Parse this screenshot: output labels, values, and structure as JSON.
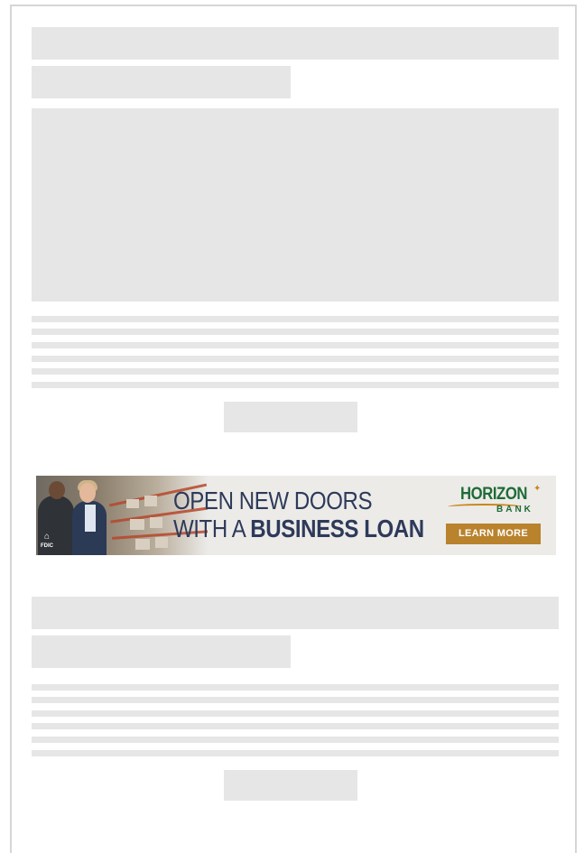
{
  "ad": {
    "headline_line1": "OPEN NEW DOORS",
    "headline_line2_prefix": "WITH A",
    "headline_line2_emphasis": "BUSINESS LOAN",
    "brand_name": "HORIZON",
    "brand_subtitle": "BANK",
    "cta_label": "LEARN MORE",
    "badge_equal_housing": "⌂",
    "badge_fdic": "FDIC",
    "colors": {
      "headline": "#2d3a5a",
      "brand_green": "#1e6b36",
      "brand_gold": "#c9861b",
      "cta_background": "#b9822c"
    }
  },
  "placeholder_color": "#e6e6e6",
  "frame_border_color": "#d6d6d6"
}
